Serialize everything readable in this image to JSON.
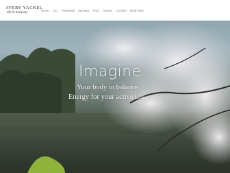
{
  "brand": {
    "name": "AVERY YACKEL",
    "tagline": "life in harmony"
  },
  "nav": {
    "items": [
      "Home",
      "Go",
      "Treatment",
      "Services",
      "FAQ",
      "Articles",
      "Contact",
      "Book Now"
    ]
  },
  "hero": {
    "headline": "Imagine.",
    "line1": "Your body in balance.",
    "line2": "Energy for your active life."
  }
}
